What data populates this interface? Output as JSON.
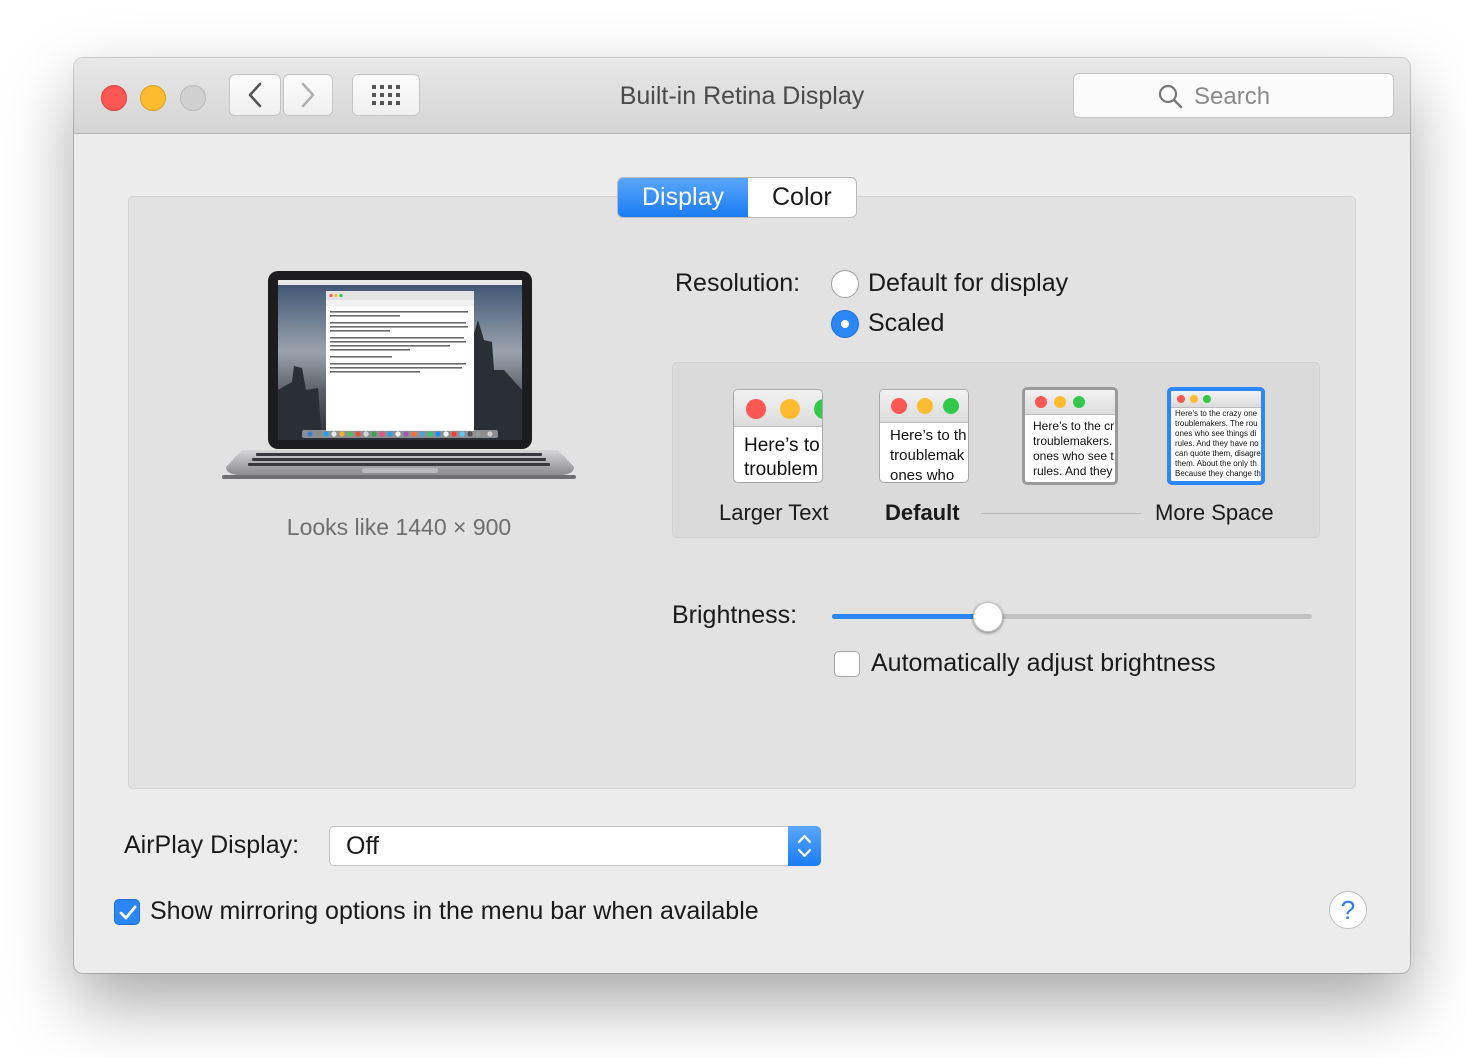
{
  "window": {
    "title": "Built-in Retina Display",
    "search_placeholder": "Search"
  },
  "tabs": [
    "Display",
    "Color"
  ],
  "active_tab": "Display",
  "preview": {
    "looks_like": "Looks like 1440 × 900"
  },
  "resolution": {
    "label": "Resolution:",
    "options": [
      "Default for display",
      "Scaled"
    ],
    "selected": "Scaled"
  },
  "scaled": {
    "thumbnails": [
      {
        "text1": "Here’s to",
        "text2": "troublem"
      },
      {
        "text1": "Here’s to th",
        "text2": "troublemak",
        "text3": "ones who"
      },
      {
        "text1": "Here’s to the cr",
        "text2": "troublemakers.",
        "text3": "ones who see t",
        "text4": "rules. And they"
      },
      {
        "text1": "Here’s to the crazy one",
        "text2": "troublemakers. The rou",
        "text3": "ones who see things di",
        "text4": "rules. And they have no",
        "text5": "can quote them, disagre",
        "text6": "them. About the only th",
        "text7": "Because they change th"
      }
    ],
    "labels": [
      "Larger Text",
      "Default",
      "More Space"
    ],
    "selected_index": 3
  },
  "brightness": {
    "label": "Brightness:",
    "level_fraction": 0.325,
    "auto_label": "Automatically adjust brightness",
    "auto_checked": false
  },
  "airplay": {
    "label": "AirPlay Display:",
    "value": "Off"
  },
  "mirroring": {
    "label": "Show mirroring options in the menu bar when available",
    "checked": true
  },
  "colors": {
    "accent": "#1a7cf3",
    "close": "#fc5753",
    "minimize": "#fdbc2f",
    "zoom_disabled": "#d0d0d0"
  },
  "icons": [
    "back-chevron-icon",
    "forward-chevron-icon",
    "grid-icon",
    "search-icon",
    "help-icon",
    "checkmark-icon",
    "updown-arrows-icon"
  ]
}
